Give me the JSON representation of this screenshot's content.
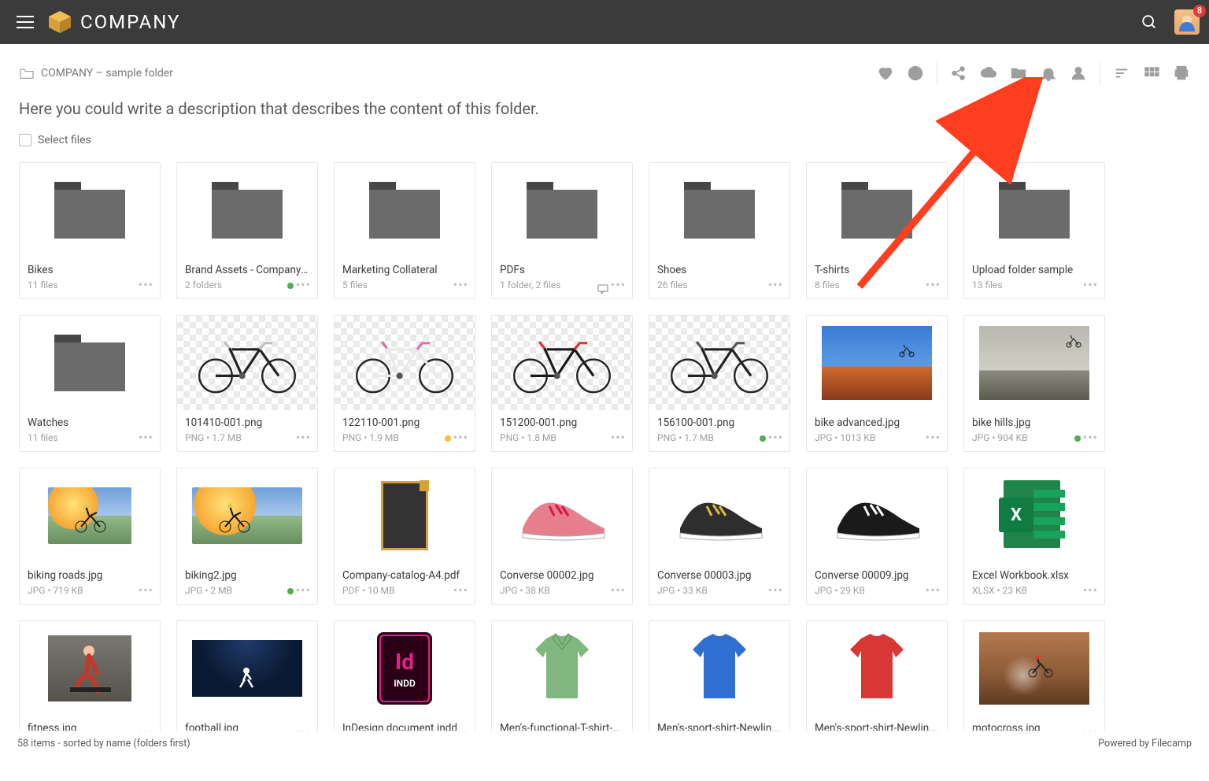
{
  "header": {
    "company_name": "COMPANY",
    "notification_count": "8"
  },
  "breadcrumb": {
    "folder_name": "COMPANY – sample folder"
  },
  "description_text": "Here you could write a description that describes the content of this folder.",
  "select_files_label": "Select files",
  "footer": {
    "status": "58 items - sorted by name (folders first)",
    "powered": "Powered by Filecamp"
  },
  "items": [
    {
      "name": "Bikes",
      "meta": "11 files",
      "type": "folder"
    },
    {
      "name": "Brand Assets - Company Inc",
      "meta": "2 folders",
      "type": "folder",
      "status": "green"
    },
    {
      "name": "Marketing Collateral",
      "meta": "5 files",
      "type": "folder"
    },
    {
      "name": "PDFs",
      "meta": "1 folder, 2 files",
      "type": "folder",
      "comment": true
    },
    {
      "name": "Shoes",
      "meta": "26 files",
      "type": "folder"
    },
    {
      "name": "T-shirts",
      "meta": "8 files",
      "type": "folder"
    },
    {
      "name": "Upload folder sample",
      "meta": "13 files",
      "type": "folder"
    },
    {
      "name": "Watches",
      "meta": "11 files",
      "type": "folder"
    },
    {
      "name": "101410-001.png",
      "meta": "PNG • 1.7 MB",
      "type": "bike",
      "checker": true
    },
    {
      "name": "122110-001.png",
      "meta": "PNG • 1.9 MB",
      "type": "bike-pink",
      "checker": true,
      "status": "yellow"
    },
    {
      "name": "151200-001.png",
      "meta": "PNG • 1.8 MB",
      "type": "bike-dark",
      "checker": true
    },
    {
      "name": "156100-001.png",
      "meta": "PNG • 1.7 MB",
      "type": "bike-mtb",
      "checker": true,
      "status": "green"
    },
    {
      "name": "bike advanced.jpg",
      "meta": "JPG • 1013 KB",
      "type": "sky"
    },
    {
      "name": "bike hills.jpg",
      "meta": "JPG • 904 KB",
      "type": "rock",
      "status": "green"
    },
    {
      "name": "biking roads.jpg",
      "meta": "JPG • 719 KB",
      "type": "cyclist"
    },
    {
      "name": "biking2.jpg",
      "meta": "JPG • 2 MB",
      "type": "cyclist2",
      "status": "green"
    },
    {
      "name": "Company-catalog-A4.pdf",
      "meta": "PDF • 10 MB",
      "type": "catalog"
    },
    {
      "name": "Converse 00002.jpg",
      "meta": "JPG • 38 KB",
      "type": "shoe-pink"
    },
    {
      "name": "Converse 00003.jpg",
      "meta": "JPG • 33 KB",
      "type": "shoe-yellow"
    },
    {
      "name": "Converse 00009.jpg",
      "meta": "JPG • 29 KB",
      "type": "shoe-bw"
    },
    {
      "name": "Excel Workbook.xlsx",
      "meta": "XLSX • 23 KB",
      "type": "xlsx"
    },
    {
      "name": "fitness.jpg",
      "meta": "",
      "type": "gym"
    },
    {
      "name": "football.jpg",
      "meta": "",
      "type": "stadium"
    },
    {
      "name": "InDesign document.indd",
      "meta": "",
      "type": "indd"
    },
    {
      "name": "Men's-functional-T-shirt-Brule",
      "meta": "",
      "type": "shirt-green"
    },
    {
      "name": "Men's-sport-shirt-Newline-blue",
      "meta": "",
      "type": "shirt-blue"
    },
    {
      "name": "Men's-sport-shirt-Newline-red",
      "meta": "",
      "type": "shirt-red"
    },
    {
      "name": "motocross.jpg",
      "meta": "",
      "type": "moto"
    }
  ],
  "icons": {
    "menu": "menu",
    "search": "search",
    "heart": "favorite",
    "info": "info",
    "share": "share",
    "upload": "upload",
    "newfolder": "new-folder",
    "bell": "notifications",
    "user": "user",
    "sort": "sort",
    "grid": "grid-view",
    "print": "print"
  },
  "indd_label": "INDD"
}
